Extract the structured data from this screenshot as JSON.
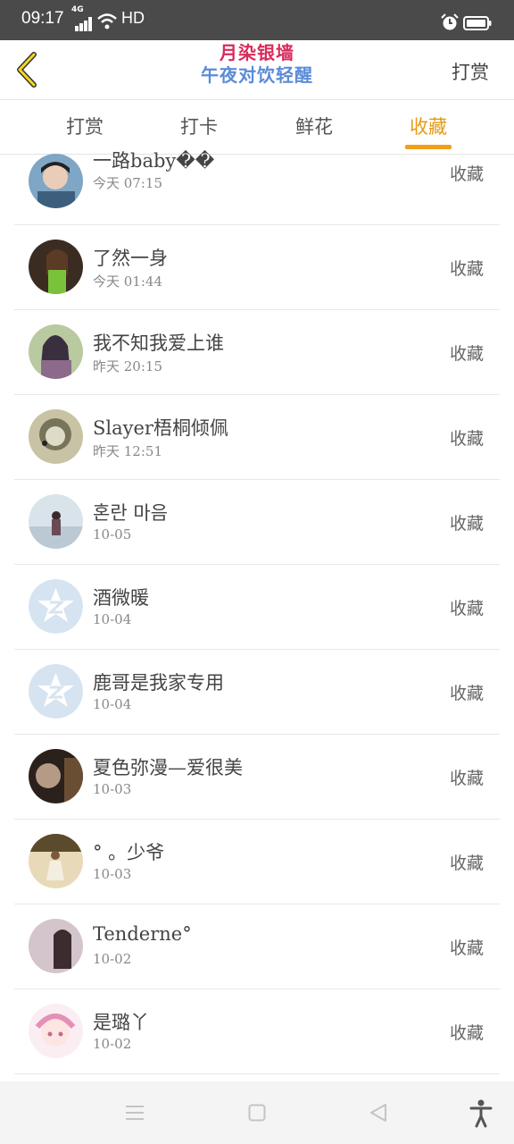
{
  "status_bar": {
    "time": "09:17",
    "network": "4G",
    "hd": "HD"
  },
  "header": {
    "brand_top": "月染银墙",
    "brand_bottom": "午夜对饮轻醒",
    "right_button": "打赏"
  },
  "tabs": [
    {
      "label": "打赏",
      "active": false
    },
    {
      "label": "打卡",
      "active": false
    },
    {
      "label": "鲜花",
      "active": false
    },
    {
      "label": "收藏",
      "active": true
    }
  ],
  "accent_color": "#f0a019",
  "items": [
    {
      "name": "一路baby��",
      "time": "今天 07:15",
      "action": "收藏",
      "avatar": "photo-boy"
    },
    {
      "name": "了然一身",
      "time": "今天 01:44",
      "action": "收藏",
      "avatar": "photo-girl-green"
    },
    {
      "name": "我不知我爱上谁",
      "time": "昨天 20:15",
      "action": "收藏",
      "avatar": "photo-girl-scarf"
    },
    {
      "name": "Slayer梧桐倾佩",
      "time": "昨天 12:51",
      "action": "收藏",
      "avatar": "photo-cartoon-child"
    },
    {
      "name": "혼란 마음",
      "time": "10-05",
      "action": "收藏",
      "avatar": "photo-beach"
    },
    {
      "name": "酒微暖",
      "time": "10-04",
      "action": "收藏",
      "avatar": "default-qzone"
    },
    {
      "name": "鹿哥是我家专用",
      "time": "10-04",
      "action": "收藏",
      "avatar": "default-qzone"
    },
    {
      "name": "夏色弥漫—爱很美",
      "time": "10-03",
      "action": "收藏",
      "avatar": "photo-dark"
    },
    {
      "name": "°  。少爷",
      "time": "10-03",
      "action": "收藏",
      "avatar": "photo-dancer"
    },
    {
      "name": "Tenderne°",
      "time": "10-02",
      "action": "收藏",
      "avatar": "photo-girl-purple"
    },
    {
      "name": "是璐丫",
      "time": "10-02",
      "action": "收藏",
      "avatar": "photo-anime"
    }
  ]
}
